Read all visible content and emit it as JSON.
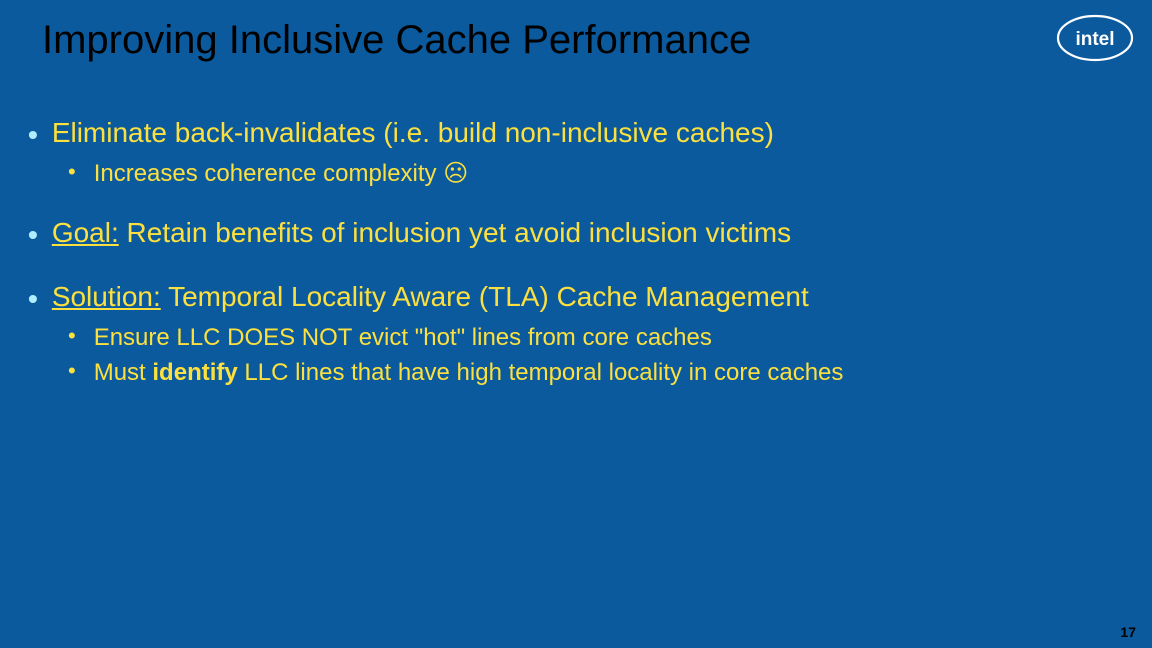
{
  "title": "Improving Inclusive Cache Performance",
  "logo": {
    "name": "intel"
  },
  "bullets": {
    "b1": {
      "text": "Eliminate back-invalidates (i.e. build non-inclusive caches)",
      "sub": [
        "Increases coherence complexity ☹"
      ]
    },
    "b2": {
      "prefix": "Goal:",
      "text": "Retain benefits of inclusion yet avoid inclusion victims"
    },
    "b3": {
      "prefix": "Solution:",
      "text": "Temporal Locality Aware (TLA) Cache Management",
      "sub": [
        {
          "pre": "Ensure LLC DOES NOT evict \"hot\" lines from core caches"
        },
        {
          "pre": "Must ",
          "bold": "identify",
          "post": " LLC lines that have high temporal locality in core caches"
        }
      ]
    }
  },
  "pageNumber": "17"
}
